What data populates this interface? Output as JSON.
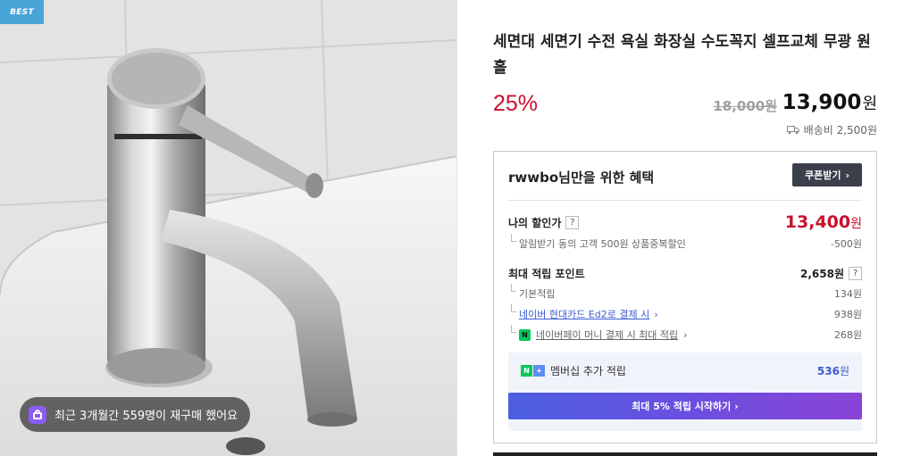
{
  "gallery": {
    "badge": "BEST",
    "repurchase_text": "최근 3개월간 559명이 재구매 했어요",
    "repurchase_icon": "shopping-bag-icon"
  },
  "product": {
    "title": "세면대 세면기 수전 욕실 화장실 수도꼭지 셀프교체 무광 원홀",
    "discount_rate": "25%",
    "original_price": "18,000원",
    "sale_price": "13,900",
    "sale_price_unit": "원",
    "shipping": "배송비 2,500원",
    "shipping_icon": "truck-icon"
  },
  "benefit": {
    "user_id": "rwwbo",
    "header_suffix": "님만을 위한 혜택",
    "coupon_button": "쿠폰받기",
    "my_discount_label": "나의 할인가",
    "my_discount_price": "13,400",
    "my_discount_unit": "원",
    "discount_detail_label": "알림받기 동의 고객 500원 상품중복할인",
    "discount_detail_value": "-500원",
    "max_point_label": "최대 적립 포인트",
    "max_point_value": "2,658원",
    "points": [
      {
        "label": "기본적립",
        "value": "134원",
        "link": false
      },
      {
        "label": "네이버 현대카드 Ed2로 결제 시",
        "value": "938원",
        "link": true
      },
      {
        "label": "네이버페이 머니 결제 시 최대 적립",
        "value": "268원",
        "link": false
      }
    ],
    "member_label": "멤버십 추가 적립",
    "member_value": "536",
    "member_unit": "원",
    "start_button": "최대 5% 적립 시작하기",
    "question_mark": "?",
    "chevron": "›"
  },
  "colors": {
    "accent_red": "#c8102e",
    "link_blue": "#3c5bd1",
    "naver_green": "#03c75a",
    "best_blue": "#49a4d8"
  }
}
